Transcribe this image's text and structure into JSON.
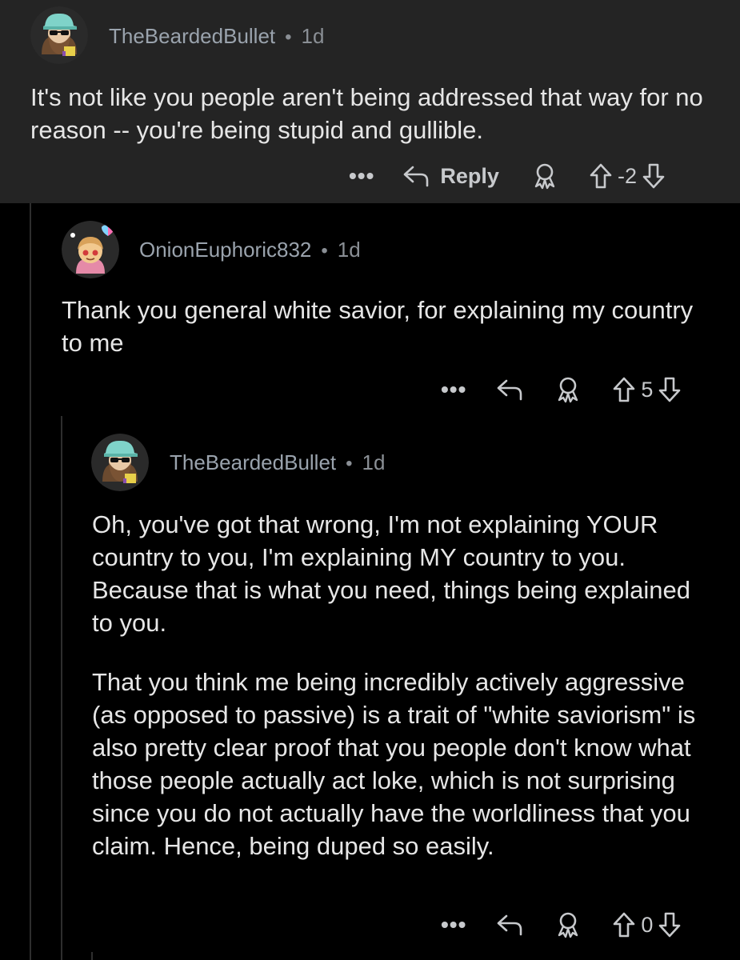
{
  "comments": [
    {
      "username": "TheBeardedBullet",
      "separator": "•",
      "age": "1d",
      "paragraphs": [
        "It's not like you people aren't being addressed that way for no reason -- you're being stupid and gullible."
      ],
      "actions": {
        "more_label": "•••",
        "reply_label": "Reply",
        "award_icon": "award-icon",
        "upvote_icon": "upvote-arrow-icon",
        "score": "-2",
        "downvote_icon": "downvote-arrow-icon"
      },
      "highlighted": true
    },
    {
      "username": "OnionEuphoric832",
      "separator": "•",
      "age": "1d",
      "paragraphs": [
        "Thank you general white savior, for explaining my country to me"
      ],
      "actions": {
        "more_label": "•••",
        "reply_icon": "reply-arrow-icon",
        "award_icon": "award-icon",
        "upvote_icon": "upvote-arrow-icon",
        "score": "5",
        "downvote_icon": "downvote-arrow-icon"
      }
    },
    {
      "username": "TheBeardedBullet",
      "separator": "•",
      "age": "1d",
      "paragraphs": [
        "Oh, you've got that wrong, I'm not explaining YOUR country to you, I'm explaining MY country to you.  Because that is what you need, things being explained to you.",
        "That you think me being incredibly actively aggressive (as opposed to passive) is a trait of \"white saviorism\" is also pretty clear proof that you people don't know what those people actually act loke, which is not surprising since you do not actually have the worldliness that you claim. Hence, being duped so easily."
      ],
      "actions": {
        "more_label": "•••",
        "reply_icon": "reply-arrow-icon",
        "award_icon": "award-icon",
        "upvote_icon": "upvote-arrow-icon",
        "score": "0",
        "downvote_icon": "downvote-arrow-icon"
      }
    }
  ],
  "colors": {
    "background": "#000000",
    "highlight_background": "#242424",
    "username": "#9aa3ad",
    "body_text": "#e6e6e6",
    "action_text": "#c7c9cc",
    "thread_line": "#2e2e2e"
  }
}
